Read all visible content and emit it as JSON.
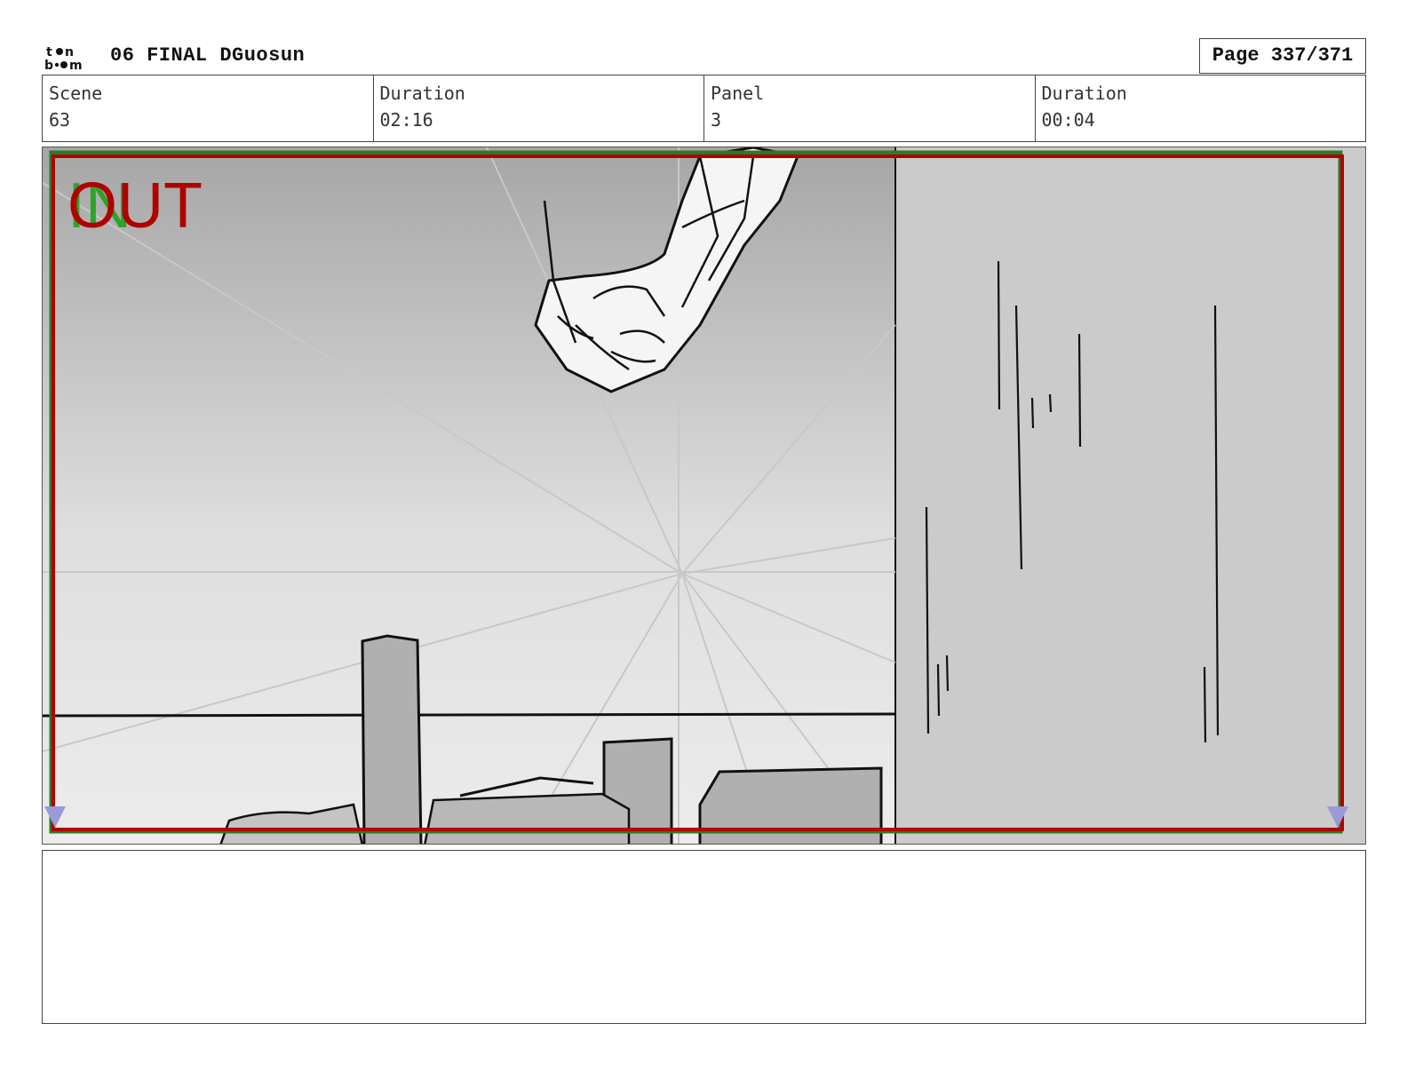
{
  "header": {
    "logo_line1": "toon",
    "logo_line2": "boom",
    "title": "06 FINAL DGuosun",
    "page": "Page 337/371"
  },
  "info": {
    "scene_label": "Scene",
    "scene_value": "63",
    "scene_duration_label": "Duration",
    "scene_duration_value": "02:16",
    "panel_label": "Panel",
    "panel_value": "3",
    "panel_duration_label": "Duration",
    "panel_duration_value": "00:04"
  },
  "panel": {
    "in_label": "IN",
    "out_label": "OUT"
  },
  "notes": {
    "text": ""
  }
}
